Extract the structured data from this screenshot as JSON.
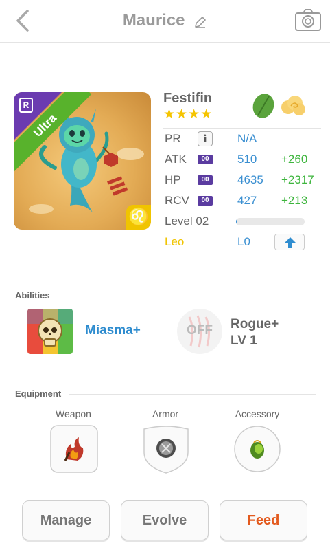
{
  "header": {
    "title": "Maurice",
    "back_icon": "chevron-left-icon",
    "edit_icon": "pencil-icon",
    "camera_icon": "camera-icon"
  },
  "monster": {
    "name": "Festifin",
    "rarity_letter": "R",
    "rarity_label": "Ultra",
    "stars": "★★★★",
    "star_count": 4,
    "elements": [
      "leaf-icon",
      "cloud-icon"
    ],
    "zodiac_glyph": "♌"
  },
  "stats": {
    "pr": {
      "label": "PR",
      "value": "N/A"
    },
    "atk": {
      "label": "ATK",
      "badge": "00",
      "value": "510",
      "plus": "+260"
    },
    "hp": {
      "label": "HP",
      "badge": "00",
      "value": "4635",
      "plus": "+2317"
    },
    "rcv": {
      "label": "RCV",
      "badge": "00",
      "value": "427",
      "plus": "+213"
    },
    "level": {
      "label": "Level 02",
      "progress": 0.02
    },
    "sign": {
      "label": "Leo",
      "value": "L0"
    }
  },
  "abilities": {
    "section_label": "Abilities",
    "active_name": "Miasma+",
    "leader_status": "OFF",
    "leader_name": "Rogue+",
    "leader_level": "LV 1"
  },
  "equipment": {
    "section_label": "Equipment",
    "slots": [
      {
        "label": "Weapon"
      },
      {
        "label": "Armor"
      },
      {
        "label": "Accessory"
      }
    ]
  },
  "actions": {
    "manage": "Manage",
    "evolve": "Evolve",
    "feed": "Feed"
  },
  "colors": {
    "accent_blue": "#3a8fd1",
    "bonus_green": "#3db53d",
    "ultra_green": "#58b22c",
    "rarity_purple": "#6b3bb0",
    "zodiac_yellow": "#f0c400",
    "feed_orange": "#e35a1e"
  }
}
